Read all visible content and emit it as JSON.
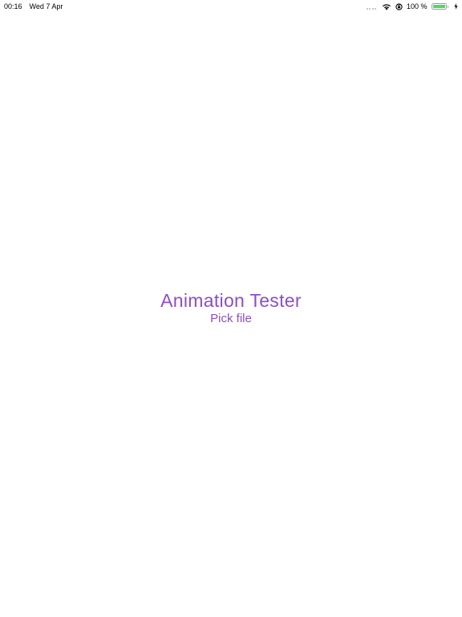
{
  "status_bar": {
    "time": "00:16",
    "date": "Wed 7 Apr",
    "battery_percent": "100 %",
    "battery_level": 1.0,
    "icons": [
      "signal-dots-icon",
      "wifi-icon",
      "orientation-lock-icon",
      "battery-icon",
      "charging-bolt-icon"
    ],
    "battery_color": "#4cd964"
  },
  "main": {
    "title": "Animation Tester",
    "pick_file_label": "Pick file",
    "accent_color": "#8e4ec6"
  }
}
